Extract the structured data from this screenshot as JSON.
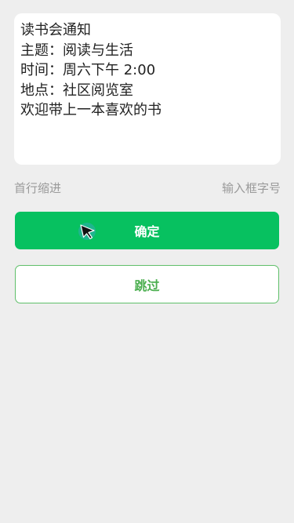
{
  "editor": {
    "lines": [
      "读书会通知",
      "主题：阅读与生活",
      "时间：周六下午 2:00",
      "地点：社区阅览室",
      "欢迎带上一本喜欢的书"
    ]
  },
  "options": {
    "first_line_indent": "首行缩进",
    "input_font_size": "输入框字号"
  },
  "buttons": {
    "confirm": "确定",
    "skip": "跳过"
  },
  "colors": {
    "accent": "#07c160",
    "skip_border": "#5fbf6a",
    "background": "#eeeeee"
  },
  "icons": {
    "cursor": "mouse-pointer-icon"
  }
}
